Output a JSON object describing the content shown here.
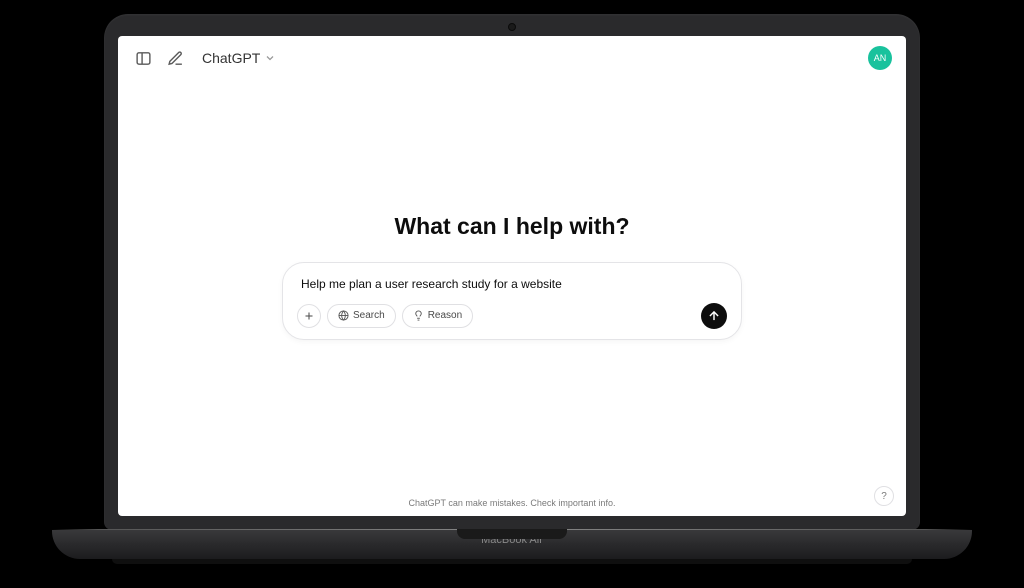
{
  "device": {
    "model_label": "MacBook Air"
  },
  "topbar": {
    "title": "ChatGPT",
    "avatar_initials": "AN"
  },
  "main": {
    "heading": "What can I help with?",
    "input_value": "Help me plan a user research study for a website"
  },
  "controls": {
    "search_label": "Search",
    "reason_label": "Reason"
  },
  "footer": {
    "disclaimer": "ChatGPT can make mistakes. Check important info."
  },
  "help": {
    "label": "?"
  }
}
